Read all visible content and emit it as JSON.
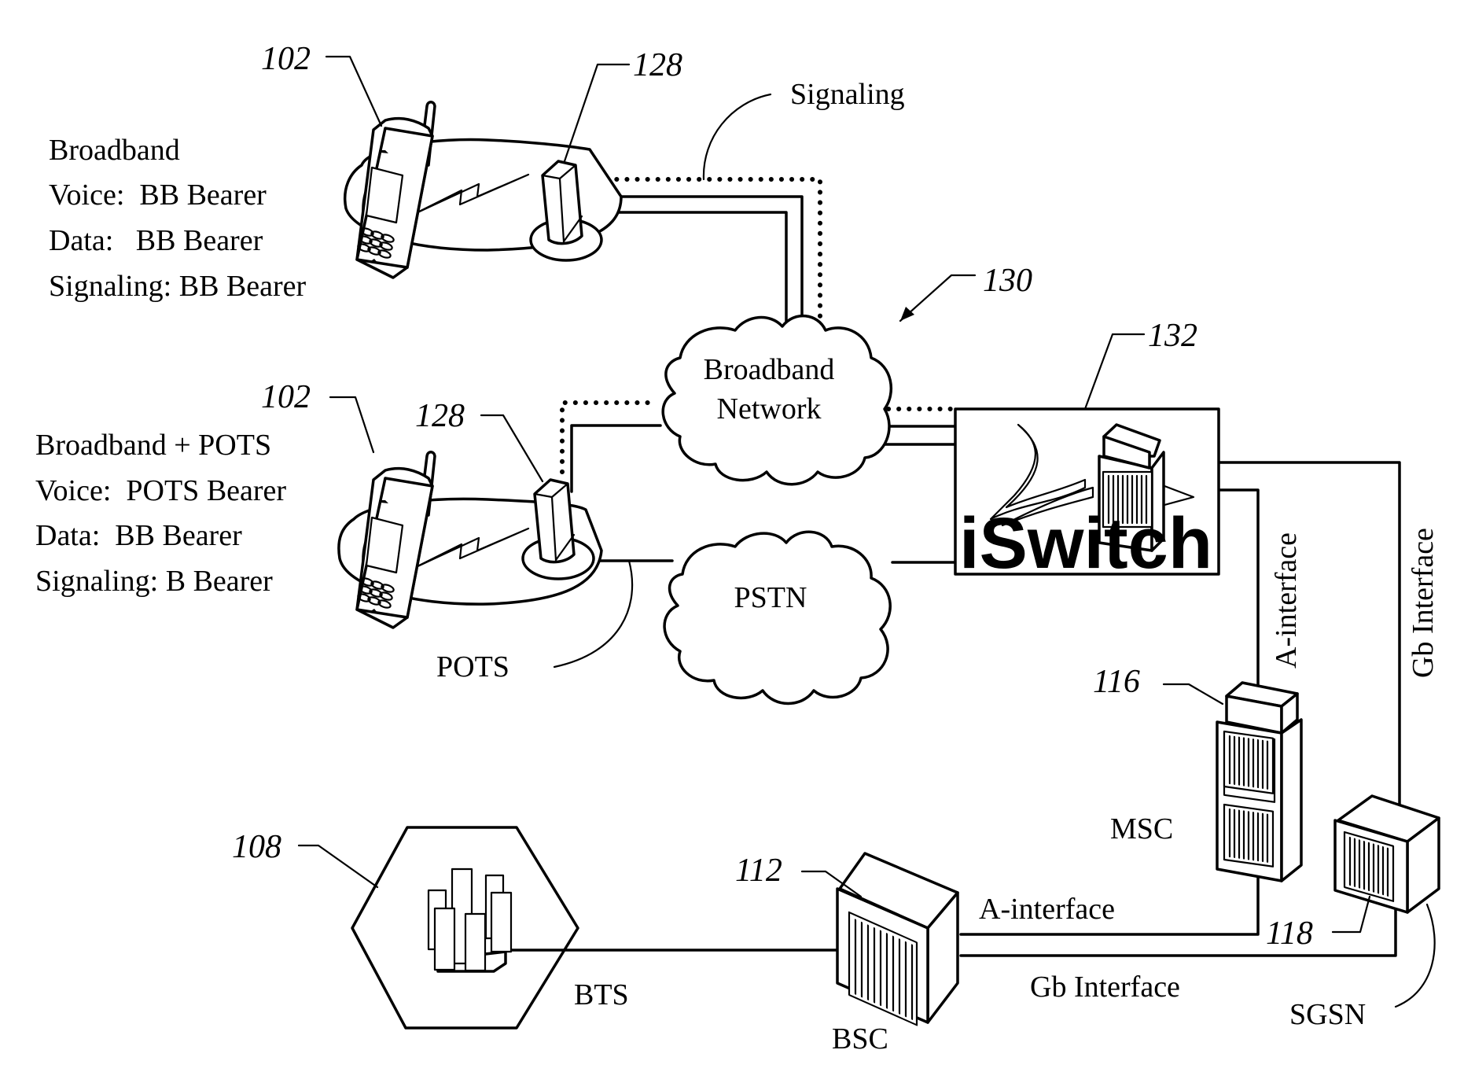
{
  "figure": {
    "type": "network-architecture-diagram",
    "reference_labels": {
      "mobile_station_top": "102",
      "mobile_station_bottom": "102",
      "access_point_top": "128",
      "access_point_bottom": "128",
      "network_overall": "130",
      "iswitch": "132",
      "msc": "116",
      "sgsn": "118",
      "bts_cell": "108",
      "bsc": "112"
    },
    "top_client": {
      "lines": [
        "Broadband",
        "Voice:  BB Bearer",
        "Data:   BB Bearer",
        "Signaling: BB Bearer"
      ]
    },
    "bottom_client": {
      "lines": [
        "Broadband + POTS",
        "Voice:  POTS Bearer",
        "Data:  BB Bearer",
        "Signaling: B Bearer"
      ]
    },
    "labels": {
      "signaling": "Signaling",
      "pots": "POTS",
      "broadband_network_line1": "Broadband",
      "broadband_network_line2": "Network",
      "pstn": "PSTN",
      "iswitch_logo": "iSwitch",
      "a_interface_vertical": "A-interface",
      "gb_interface_vertical": "Gb Interface",
      "msc": "MSC",
      "sgsn": "SGSN",
      "bts": "BTS",
      "bsc": "BSC",
      "a_interface_horizontal": "A-interface",
      "gb_interface_horizontal": "Gb Interface"
    },
    "icons": {
      "mobile_phone": "mobile-phone-icon",
      "access_point": "access-point-tower-icon",
      "cloud": "cloud-icon",
      "server_rack": "server-rack-icon",
      "bts_buildings": "city-buildings-icon",
      "lightning": "wireless-link-icon"
    }
  }
}
